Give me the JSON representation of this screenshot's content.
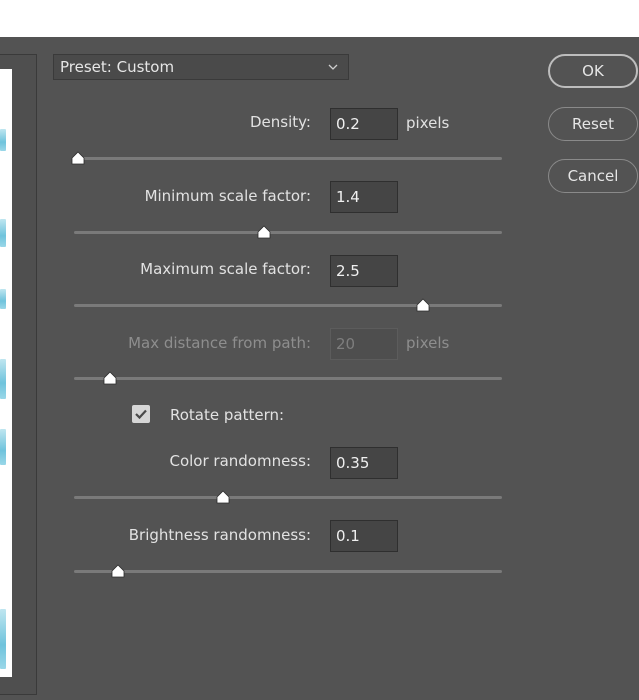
{
  "preset": {
    "label": "Preset: Custom"
  },
  "buttons": {
    "ok": "OK",
    "reset": "Reset",
    "cancel": "Cancel"
  },
  "fields": [
    {
      "label": "Density:",
      "value": "0.2",
      "unit": "pixels",
      "slider_fraction": 0.01,
      "enabled": true
    },
    {
      "label": "Minimum scale factor:",
      "value": "1.4",
      "unit": "",
      "slider_fraction": 0.445,
      "enabled": true
    },
    {
      "label": "Maximum scale factor:",
      "value": "2.5",
      "unit": "",
      "slider_fraction": 0.816,
      "enabled": true
    },
    {
      "label": "Max distance from path:",
      "value": "20",
      "unit": "pixels",
      "slider_fraction": 0.084,
      "enabled": false
    },
    {
      "label": "Color randomness:",
      "value": "0.35",
      "unit": "",
      "slider_fraction": 0.348,
      "enabled": true
    },
    {
      "label": "Brightness randomness:",
      "value": "0.1",
      "unit": "",
      "slider_fraction": 0.103,
      "enabled": true
    }
  ],
  "rotate": {
    "label": "Rotate pattern:",
    "checked": true
  },
  "colors": {
    "panel": "#535353",
    "accent_preview": "#6fc3dc"
  }
}
